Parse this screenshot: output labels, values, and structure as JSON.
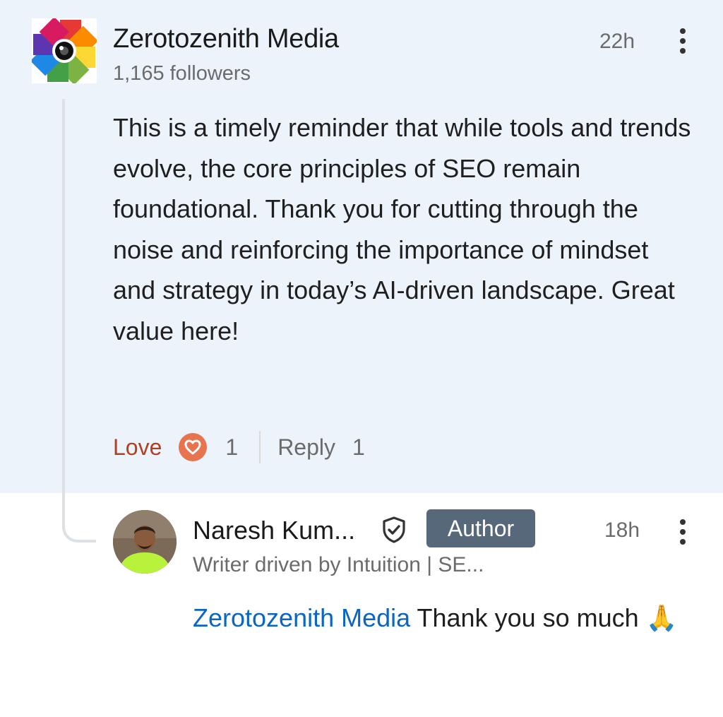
{
  "comment": {
    "author_name": "Zerotozenith Media",
    "followers": "1,165 followers",
    "time": "22h",
    "text": "This is a timely reminder that while tools and trends evolve, the core principles of SEO remain foundational. Thank you for cutting through the noise and reinforcing the importance of mindset and strategy in today’s AI-driven landscape. Great value here!",
    "reaction_label": "Love",
    "reaction_count": "1",
    "reply_label": "Reply",
    "reply_count": "1",
    "reaction_icon": "love-reaction-icon",
    "background_color": "#edf3fb",
    "reaction_color": "#b24020"
  },
  "reply": {
    "author_name": "Naresh Kum...",
    "badge": "Author",
    "headline": "Writer driven by Intuition | SE...",
    "time": "18h",
    "mention": "Zerotozenith Media",
    "text": " Thank you so much ",
    "emoji": "🙏",
    "mention_color": "#0a66c2",
    "badge_color": "#56687a"
  }
}
